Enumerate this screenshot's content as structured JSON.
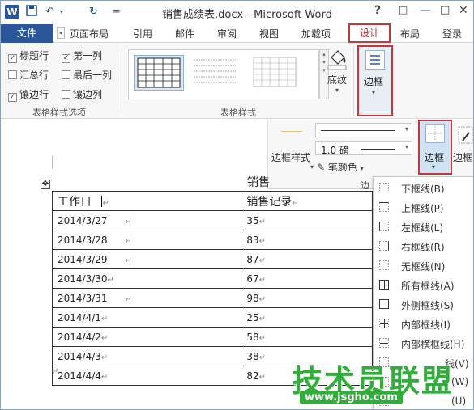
{
  "window": {
    "title": "销售成绩表.docx - Microsoft Word",
    "help": "?",
    "restore": "□",
    "minimize": "—",
    "maximize": "□",
    "close": "✕"
  },
  "quick_access": {
    "undo": "↶",
    "redo": "↻",
    "more": "="
  },
  "tabs": {
    "file": "文件",
    "items": [
      "页面布局",
      "引用",
      "邮件",
      "审阅",
      "视图",
      "加载项",
      "设计",
      "布局"
    ],
    "login": "登录"
  },
  "ribbon": {
    "style_options": {
      "checkboxes": [
        {
          "label": "标题行",
          "checked": true
        },
        {
          "label": "第一列",
          "checked": true
        },
        {
          "label": "汇总行",
          "checked": false
        },
        {
          "label": "最后一列",
          "checked": false
        },
        {
          "label": "镶边行",
          "checked": true
        },
        {
          "label": "镶边列",
          "checked": false
        }
      ],
      "group_label": "表格样式选项"
    },
    "table_styles": {
      "group_label": "表格样式"
    },
    "shading": {
      "label": "底纹"
    },
    "borders": {
      "label": "边框"
    }
  },
  "border_tools": {
    "border_styles": "边框样式",
    "weight": "1.0 磅",
    "pen_color": "笔颜色",
    "borders": "边框",
    "border_painter": "边框",
    "group_label": "边"
  },
  "document": {
    "title_fragment": "销售",
    "table": {
      "headers": [
        "工作日",
        "销售记录"
      ],
      "rows": [
        [
          "2014/3/27",
          "35"
        ],
        [
          "2014/3/28",
          "83"
        ],
        [
          "2014/3/29",
          "87"
        ],
        [
          "2014/3/30",
          "67"
        ],
        [
          "2014/3/31",
          "98"
        ],
        [
          "2014/4/1",
          "25"
        ],
        [
          "2014/4/2",
          "58"
        ],
        [
          "2014/4/3",
          "38"
        ],
        [
          "2014/4/4",
          "82"
        ]
      ]
    }
  },
  "borders_menu": {
    "items": [
      {
        "label": "下框线(B)",
        "icon": "bottom-border-icon"
      },
      {
        "label": "上框线(P)",
        "icon": "top-border-icon"
      },
      {
        "label": "左框线(L)",
        "icon": "left-border-icon"
      },
      {
        "label": "右框线(R)",
        "icon": "right-border-icon"
      },
      {
        "label": "无框线(N)",
        "icon": "no-border-icon"
      },
      {
        "label": "所有框线(A)",
        "icon": "all-borders-icon"
      },
      {
        "label": "外侧框线(S)",
        "icon": "outside-borders-icon"
      },
      {
        "label": "内部框线(I)",
        "icon": "inside-borders-icon"
      },
      {
        "label": "内部横框线(H)",
        "icon": "inside-horizontal-border-icon"
      },
      {
        "label": "线(V)",
        "icon": "inside-vertical-border-icon"
      },
      {
        "label": "(W)",
        "icon": "diagonal-down-border-icon"
      },
      {
        "label": "(U)",
        "icon": "diagonal-up-border-icon"
      }
    ]
  },
  "watermark": {
    "text": "技术员联盟",
    "url": "www.jsgho.com"
  },
  "colors": {
    "brand": "#2b579a",
    "highlight": "#c0393b",
    "watermark": "#2fae3a"
  }
}
